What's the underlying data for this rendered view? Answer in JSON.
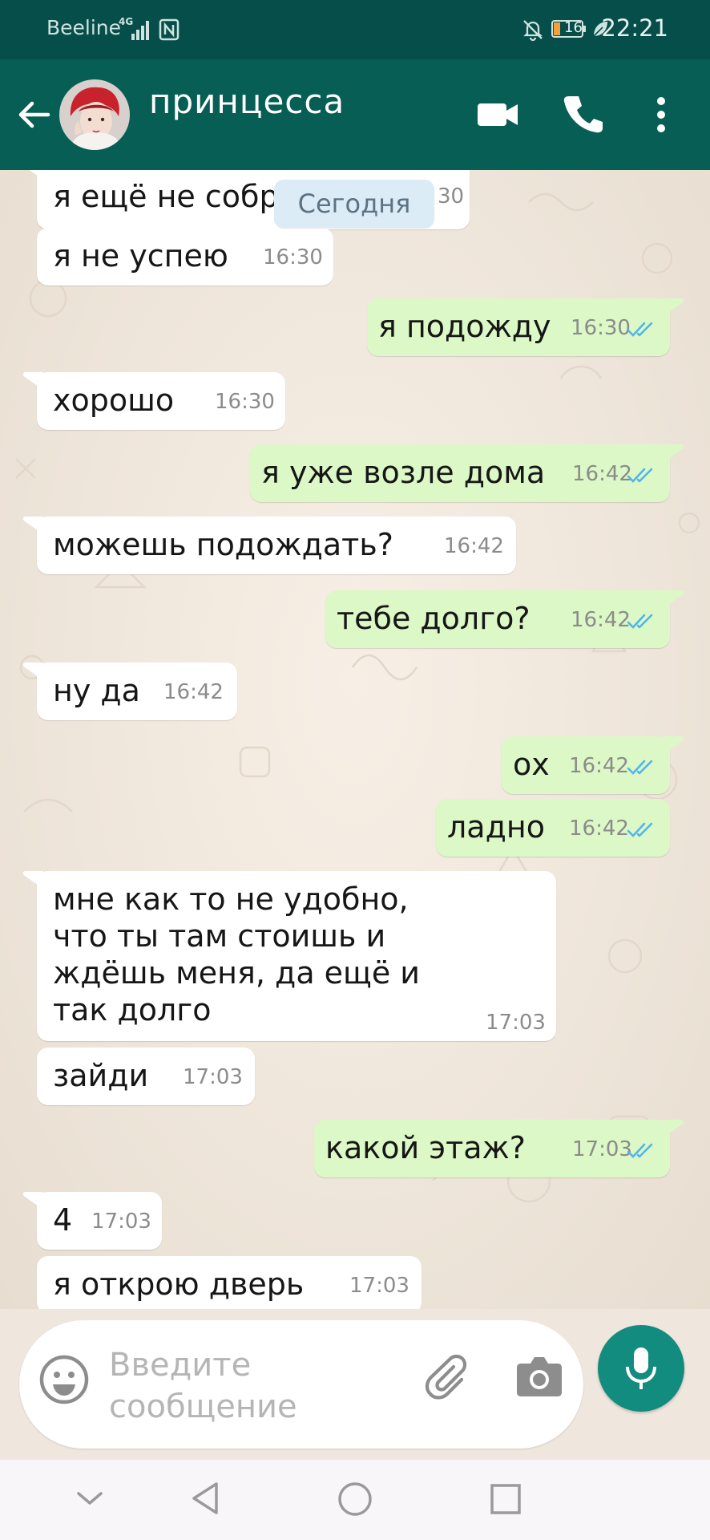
{
  "status_bar": {
    "carrier": "Beeline",
    "network_type": "4G",
    "battery_level": "16",
    "time": "22:21"
  },
  "header": {
    "contact_name": "принцесса",
    "icons": [
      "back-arrow-icon",
      "avatar",
      "video-call-icon",
      "voice-call-icon",
      "more-vert-icon"
    ]
  },
  "date_chip": "Сегодня",
  "messages": [
    {
      "direction": "in",
      "text": "я ещё не собр",
      "time": "16:30",
      "partial_time": "30"
    },
    {
      "direction": "in",
      "text": "я не успею",
      "time": "16:30"
    },
    {
      "direction": "out",
      "text": "я подожду",
      "time": "16:30",
      "status": "read"
    },
    {
      "direction": "in",
      "text": "хорошо",
      "time": "16:30"
    },
    {
      "direction": "out",
      "text": "я уже возле дома",
      "time": "16:42",
      "status": "read"
    },
    {
      "direction": "in",
      "text": "можешь подождать?",
      "time": "16:42"
    },
    {
      "direction": "out",
      "text": "тебе долго?",
      "time": "16:42",
      "status": "read"
    },
    {
      "direction": "in",
      "text": "ну да",
      "time": "16:42"
    },
    {
      "direction": "out",
      "text": "ох",
      "time": "16:42",
      "status": "read"
    },
    {
      "direction": "out",
      "text": "ладно",
      "time": "16:42",
      "status": "read"
    },
    {
      "direction": "in",
      "lines": [
        "мне как то не удобно,",
        "что ты там стоишь и",
        "ждёшь меня, да ещё и",
        "так долго"
      ],
      "time": "17:03"
    },
    {
      "direction": "in",
      "text": "зайди",
      "time": "17:03"
    },
    {
      "direction": "out",
      "text": "какой этаж?",
      "time": "17:03",
      "status": "read"
    },
    {
      "direction": "in",
      "text": "4",
      "time": "17:03"
    },
    {
      "direction": "in",
      "text": "я открою дверь",
      "time": "17:03"
    }
  ],
  "composer": {
    "placeholder_line1": "Введите",
    "placeholder_line2": "сообщение",
    "icons": [
      "emoji-icon",
      "attach-clip-icon",
      "camera-icon",
      "microphone-icon"
    ]
  },
  "nav_bar": {
    "icons": [
      "collapse-chevron-icon",
      "back-triangle-icon",
      "home-circle-icon",
      "recents-square-icon"
    ]
  },
  "colors": {
    "header": "#075e54",
    "status_bar": "#054e4a",
    "outgoing_bubble": "#dcf8c6",
    "incoming_bubble": "#ffffff",
    "read_ticks": "#4fb6ec",
    "mic_button": "#128c7e",
    "date_chip": "#dcecf6"
  }
}
